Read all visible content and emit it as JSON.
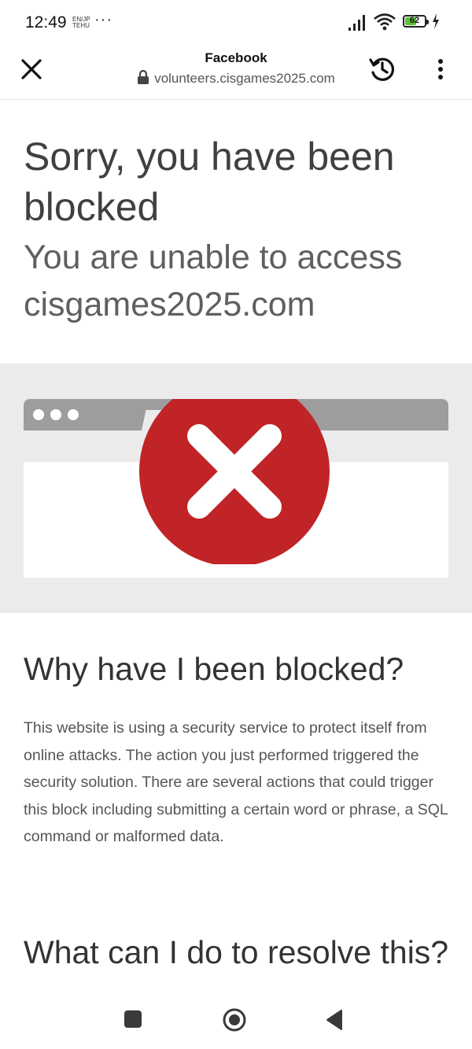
{
  "status_bar": {
    "time": "12:49",
    "notification_text": "EN/JP TEHU",
    "more": "···",
    "battery": "62",
    "battery_percent": 62
  },
  "toolbar": {
    "title": "Facebook",
    "url": "volunteers.cisgames2025.com",
    "icons": [
      "close-icon",
      "lock-icon",
      "history-icon",
      "more-vert-icon"
    ]
  },
  "page": {
    "heading": "Sorry, you have been blocked",
    "subheading": "You are unable to access cisgames2025.com",
    "why_heading": "Why have I been blocked?",
    "why_text": "This website is using a security service to protect itself from online attacks. The action you just performed triggered the security solution. There are several actions that could trigger this block including submitting a certain word or phrase, a SQL command or malformed data.",
    "resolve_heading": "What can I do to resolve this?"
  },
  "colors": {
    "error_red": "#c02427",
    "browser_grey": "#9d9d9d",
    "hero_bg": "#ebebeb",
    "battery_green": "#5bc236"
  },
  "navigation_bar": {
    "icons": [
      "recents-icon",
      "home-icon",
      "back-icon"
    ]
  }
}
